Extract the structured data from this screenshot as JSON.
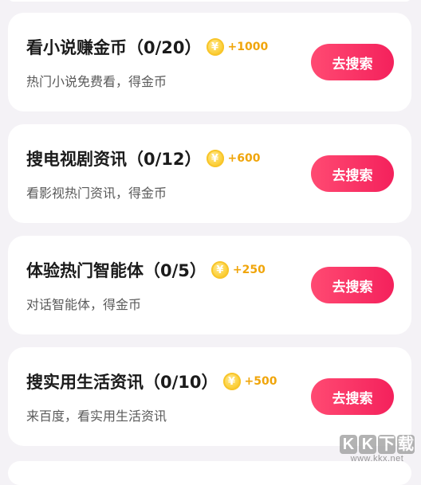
{
  "tasks": [
    {
      "title": "看小说赚金币",
      "progress": "（0/20）",
      "coin_symbol": "¥",
      "reward": "+1000",
      "subtitle": "热门小说免费看，得金币",
      "button_label": "去搜索"
    },
    {
      "title": "搜电视剧资讯",
      "progress": "（0/12）",
      "coin_symbol": "¥",
      "reward": "+600",
      "subtitle": "看影视热门资讯，得金币",
      "button_label": "去搜索"
    },
    {
      "title": "体验热门智能体",
      "progress": "（0/5）",
      "coin_symbol": "¥",
      "reward": "+250",
      "subtitle": "对话智能体，得金币",
      "button_label": "去搜索"
    },
    {
      "title": "搜实用生活资讯",
      "progress": "（0/10）",
      "coin_symbol": "¥",
      "reward": "+500",
      "subtitle": "来百度，看实用生活资讯",
      "button_label": "去搜索"
    }
  ],
  "watermark": {
    "logo_letters": [
      "K",
      "K",
      "下",
      "载"
    ],
    "url": "www.kkx.net"
  },
  "colors": {
    "background": "#f4f2f6",
    "button": "#f4215c",
    "reward": "#f0a50a",
    "coin": "#fcd13f"
  },
  "icons": {
    "coin": "gold-yuan-coin-icon"
  }
}
